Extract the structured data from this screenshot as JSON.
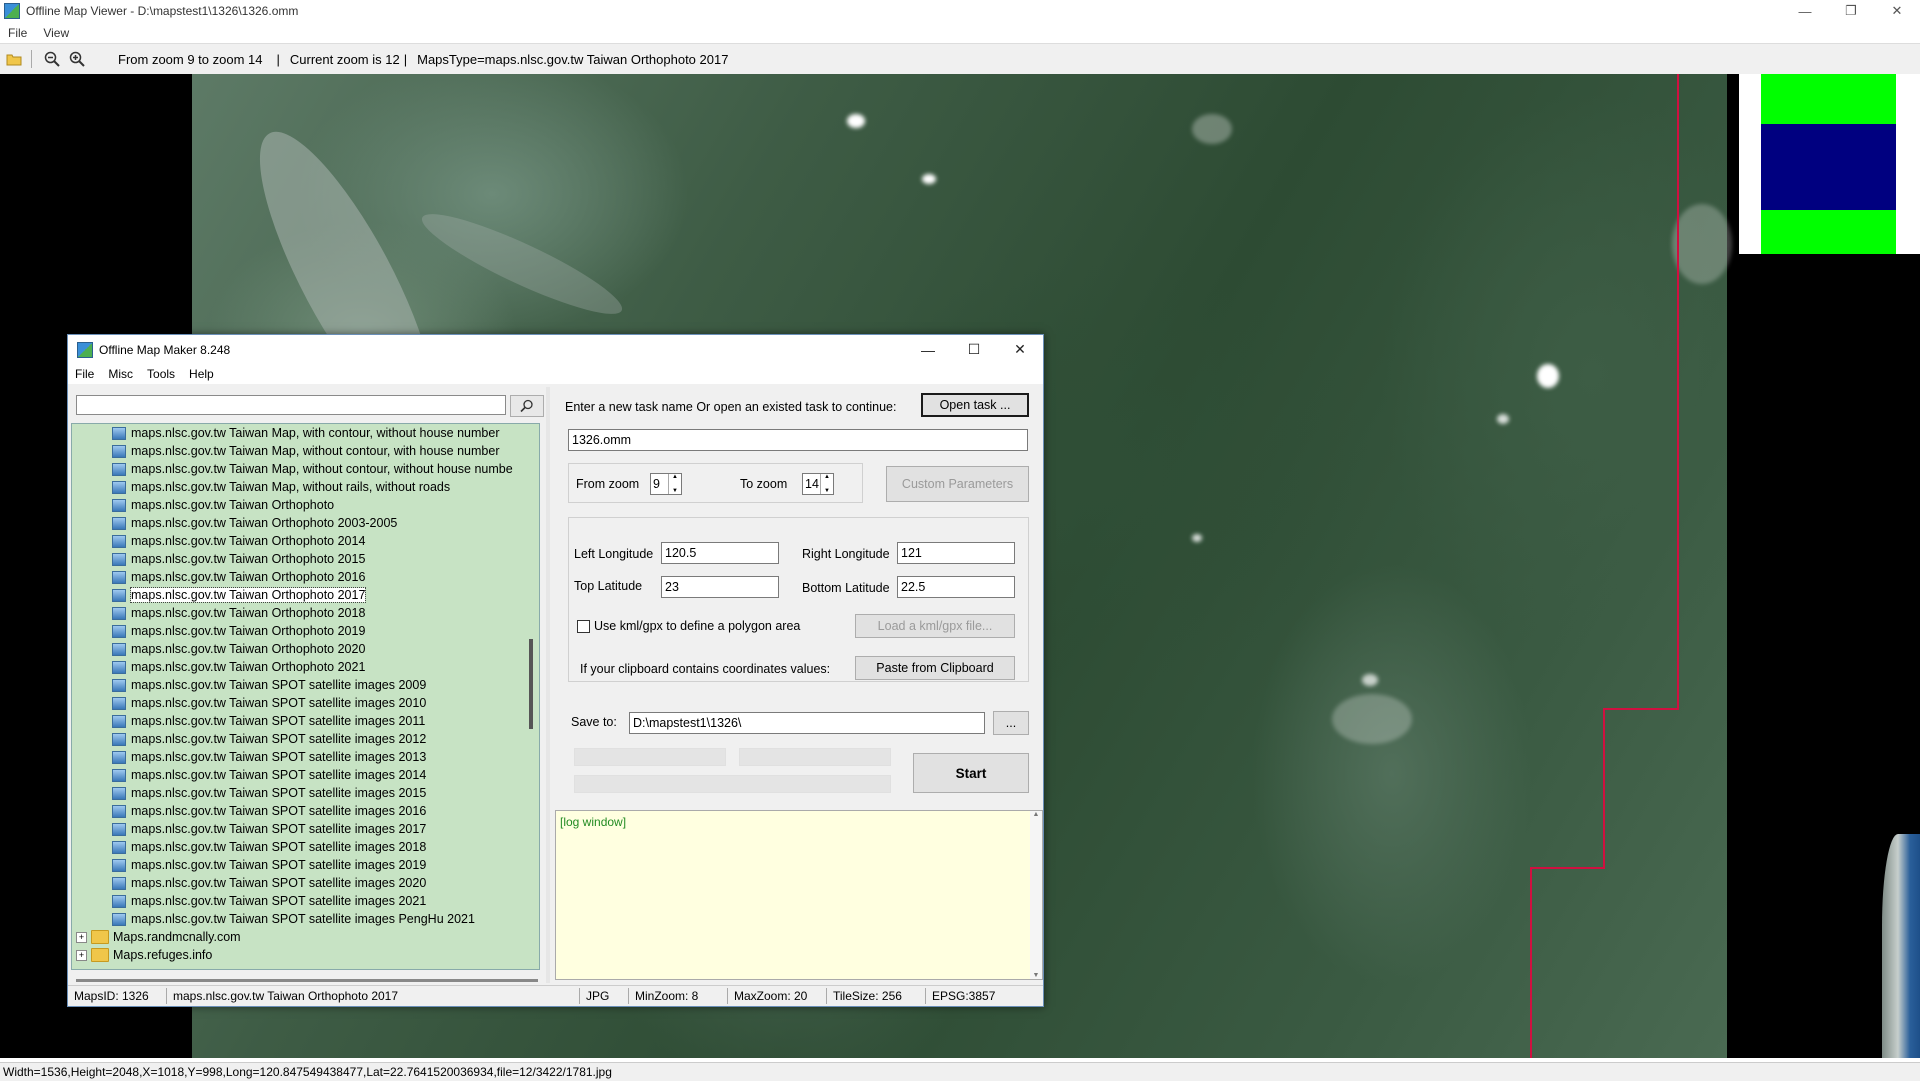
{
  "viewer": {
    "title": "Offline Map Viewer - D:\\mapstest1\\1326\\1326.omm",
    "menu": [
      "File",
      "View"
    ],
    "toolbar": {
      "zoom_range": "From zoom 9 to zoom 14",
      "current_zoom": "Current zoom is 12",
      "maps_type": "MapsType=maps.nlsc.gov.tw Taiwan Orthophoto 2017",
      "icons": [
        "folder-open-icon",
        "zoom-out-icon",
        "zoom-in-icon"
      ]
    },
    "status": "Width=1536,Height=2048,X=1018,Y=998,Long=120.847549438477,Lat=22.7641520036934,file=12/3422/1781.jpg",
    "colors": {
      "boundary": "#d01040",
      "minimap_green": "#00ff00",
      "minimap_blue": "#000080"
    }
  },
  "dialog": {
    "title": "Offline Map Maker 8.248",
    "menu": [
      "File",
      "Misc",
      "Tools",
      "Help"
    ],
    "search": {
      "value": "",
      "placeholder": ""
    },
    "tree": {
      "items": [
        "maps.nlsc.gov.tw Taiwan Map, with contour, without house number",
        "maps.nlsc.gov.tw Taiwan Map, without contour, with house number",
        "maps.nlsc.gov.tw Taiwan Map, without contour, without house numbe",
        "maps.nlsc.gov.tw Taiwan Map, without rails, without roads",
        "maps.nlsc.gov.tw Taiwan Orthophoto",
        "maps.nlsc.gov.tw Taiwan Orthophoto 2003-2005",
        "maps.nlsc.gov.tw Taiwan Orthophoto 2014",
        "maps.nlsc.gov.tw Taiwan Orthophoto 2015",
        "maps.nlsc.gov.tw Taiwan Orthophoto 2016",
        "maps.nlsc.gov.tw Taiwan Orthophoto 2017",
        "maps.nlsc.gov.tw Taiwan Orthophoto 2018",
        "maps.nlsc.gov.tw Taiwan Orthophoto 2019",
        "maps.nlsc.gov.tw Taiwan Orthophoto 2020",
        "maps.nlsc.gov.tw Taiwan Orthophoto 2021",
        "maps.nlsc.gov.tw Taiwan SPOT satellite images 2009",
        "maps.nlsc.gov.tw Taiwan SPOT satellite images 2010",
        "maps.nlsc.gov.tw Taiwan SPOT satellite images 2011",
        "maps.nlsc.gov.tw Taiwan SPOT satellite images 2012",
        "maps.nlsc.gov.tw Taiwan SPOT satellite images 2013",
        "maps.nlsc.gov.tw Taiwan SPOT satellite images 2014",
        "maps.nlsc.gov.tw Taiwan SPOT satellite images 2015",
        "maps.nlsc.gov.tw Taiwan SPOT satellite images 2016",
        "maps.nlsc.gov.tw Taiwan SPOT satellite images 2017",
        "maps.nlsc.gov.tw Taiwan SPOT satellite images 2018",
        "maps.nlsc.gov.tw Taiwan SPOT satellite images 2019",
        "maps.nlsc.gov.tw Taiwan SPOT satellite images 2020",
        "maps.nlsc.gov.tw Taiwan SPOT satellite images 2021",
        "maps.nlsc.gov.tw Taiwan SPOT satellite images PengHu 2021"
      ],
      "selected_index": 9,
      "folders": [
        "Maps.randmcnally.com",
        "Maps.refuges.info"
      ]
    },
    "task": {
      "prompt": "Enter a new task name Or open an existed task to continue:",
      "open_button": "Open task ...",
      "name_value": "1326.omm"
    },
    "zoom": {
      "from_label": "From zoom",
      "from_value": "9",
      "to_label": "To zoom",
      "to_value": "14",
      "custom_button": "Custom Parameters"
    },
    "coords": {
      "left_lon_label": "Left Longitude",
      "left_lon": "120.5",
      "right_lon_label": "Right Longitude",
      "right_lon": "121",
      "top_lat_label": "Top Latitude",
      "top_lat": "23",
      "bottom_lat_label": "Bottom Latitude",
      "bottom_lat": "22.5",
      "kml_checkbox_label": "Use kml/gpx to define a polygon area",
      "kml_button": "Load a kml/gpx file...",
      "clipboard_label": "If your clipboard contains coordinates values:",
      "clipboard_button": "Paste from Clipboard"
    },
    "save": {
      "label": "Save to:",
      "path": "D:\\mapstest1\\1326\\",
      "browse_button": "...",
      "start_button": "Start"
    },
    "log": {
      "text": "[log window]"
    },
    "status": {
      "maps_id": "MapsID: 1326",
      "maps_name": "maps.nlsc.gov.tw Taiwan Orthophoto 2017",
      "format": "JPG",
      "min_zoom": "MinZoom: 8",
      "max_zoom": "MaxZoom: 20",
      "tile_size": "TileSize: 256",
      "epsg": "EPSG:3857"
    }
  }
}
